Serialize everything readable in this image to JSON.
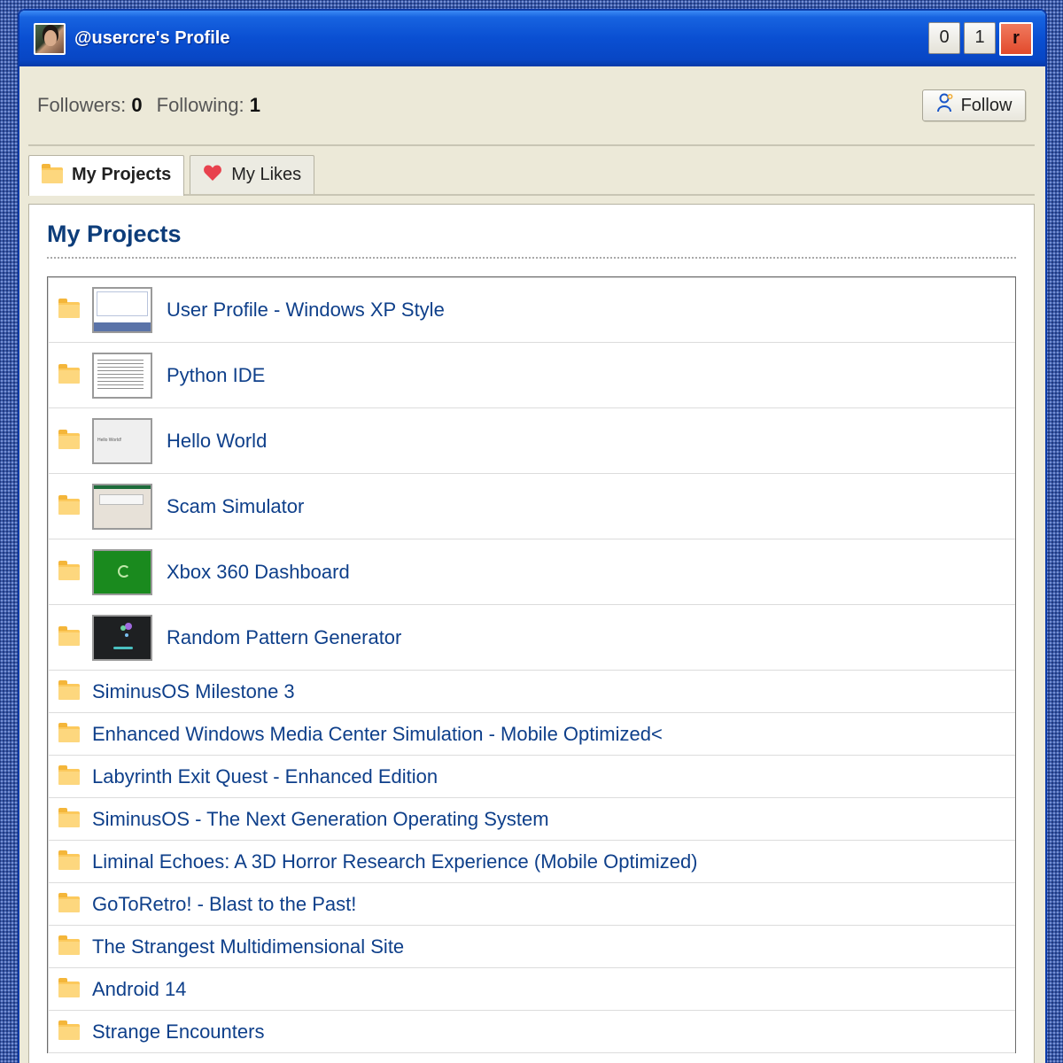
{
  "window": {
    "title": "@usercre's Profile",
    "buttons": [
      "0",
      "1",
      "r"
    ]
  },
  "stats": {
    "followers_label": "Followers:",
    "followers_count": "0",
    "following_label": "Following:",
    "following_count": "1",
    "follow_button": "Follow"
  },
  "tabs": [
    {
      "label": "My Projects",
      "icon": "folder-icon",
      "active": true
    },
    {
      "label": "My Likes",
      "icon": "heart-icon",
      "active": false
    }
  ],
  "panel": {
    "title": "My Projects"
  },
  "projects": [
    {
      "label": "User Profile - Windows XP Style",
      "thumbnail": true
    },
    {
      "label": "Python IDE",
      "thumbnail": true
    },
    {
      "label": "Hello World",
      "thumbnail": true
    },
    {
      "label": "Scam Simulator",
      "thumbnail": true
    },
    {
      "label": "Xbox 360 Dashboard",
      "thumbnail": true
    },
    {
      "label": "Random Pattern Generator",
      "thumbnail": true
    },
    {
      "label": "SiminusOS Milestone 3",
      "thumbnail": false
    },
    {
      "label": "Enhanced Windows Media Center Simulation - Mobile Optimized<",
      "thumbnail": false
    },
    {
      "label": "Labyrinth Exit Quest - Enhanced Edition",
      "thumbnail": false
    },
    {
      "label": "SiminusOS - The Next Generation Operating System",
      "thumbnail": false
    },
    {
      "label": "Liminal Echoes: A 3D Horror Research Experience (Mobile Optimized)",
      "thumbnail": false
    },
    {
      "label": "GoToRetro! - Blast to the Past!",
      "thumbnail": false
    },
    {
      "label": "The Strangest Multidimensional Site",
      "thumbnail": false
    },
    {
      "label": "Android 14",
      "thumbnail": false
    },
    {
      "label": "Strange Encounters",
      "thumbnail": false
    }
  ],
  "colors": {
    "title_bar": "#0a4fd2",
    "window_bg": "#ece9d8",
    "link": "#0e3f8a",
    "heading": "#0d3d7a",
    "folder": "#fcc95c",
    "close_button": "#e24a2c"
  }
}
